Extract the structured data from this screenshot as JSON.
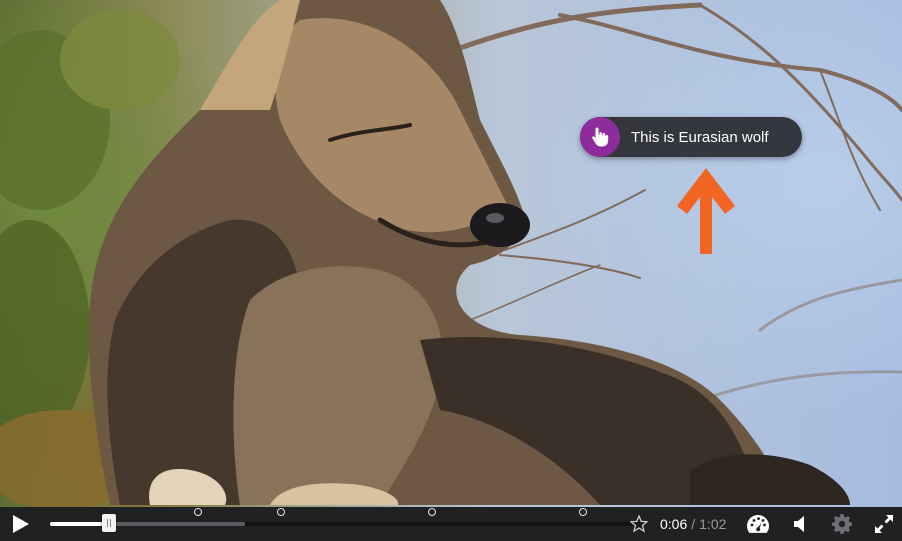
{
  "hotspot": {
    "label": "This is Eurasian wolf",
    "icon": "hand-pointer-icon",
    "badge_color": "#8e2c9e"
  },
  "annotation_arrow": {
    "color": "#f26522"
  },
  "controls": {
    "time_current": "0:06",
    "time_separator": "/",
    "time_total": "1:02",
    "played_fraction": 0.1,
    "buffered_fraction": 0.33,
    "interaction_markers_fractions": [
      0.25,
      0.39,
      0.645,
      0.9
    ]
  },
  "icons": {
    "play": "play-icon",
    "end_marker": "star-icon",
    "speed": "speedometer-icon",
    "volume": "volume-icon",
    "settings": "gear-icon",
    "fullscreen": "fullscreen-icon"
  }
}
